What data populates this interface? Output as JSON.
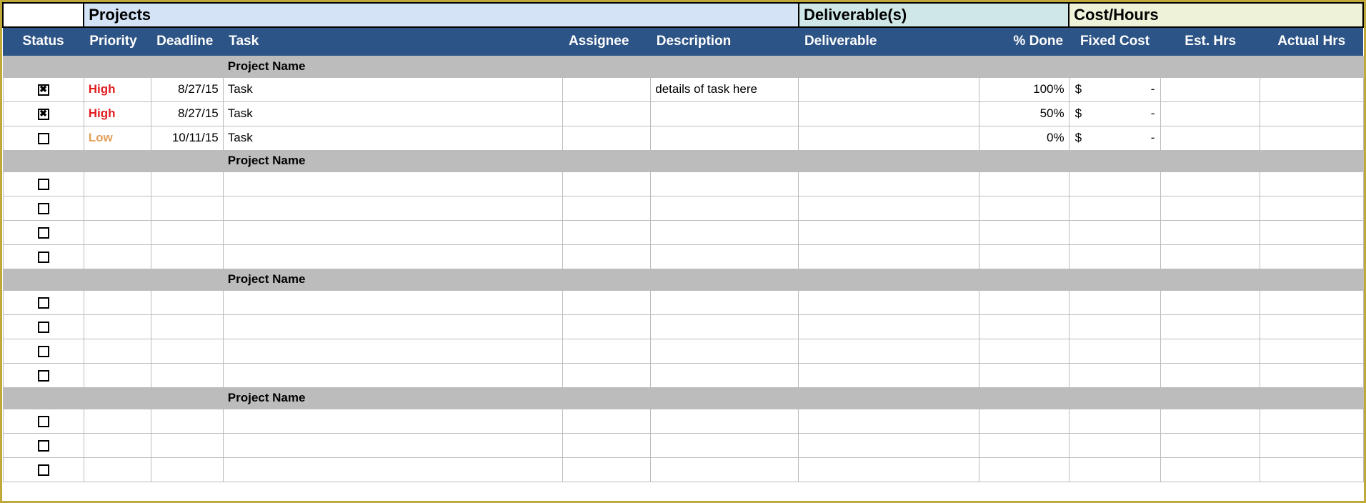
{
  "band": {
    "projects": "Projects",
    "deliverables": "Deliverable(s)",
    "cost": "Cost/Hours"
  },
  "headers": {
    "status": "Status",
    "priority": "Priority",
    "deadline": "Deadline",
    "task": "Task",
    "assignee": "Assignee",
    "description": "Description",
    "deliverable": "Deliverable",
    "done": "% Done",
    "fixed": "Fixed Cost",
    "esthrs": "Est. Hrs",
    "actualhrs": "Actual Hrs"
  },
  "groups": [
    {
      "name": "Project Name",
      "rows": [
        {
          "checked": true,
          "priority": "High",
          "deadline": "8/27/15",
          "task": "Task",
          "assignee": "",
          "description": "details of task here",
          "deliverable": "",
          "done": "100%",
          "fixed_sym": "$",
          "fixed_val": "-",
          "est": "",
          "actual": ""
        },
        {
          "checked": true,
          "priority": "High",
          "deadline": "8/27/15",
          "task": "Task",
          "assignee": "",
          "description": "",
          "deliverable": "",
          "done": "50%",
          "fixed_sym": "$",
          "fixed_val": "-",
          "est": "",
          "actual": ""
        },
        {
          "checked": false,
          "priority": "Low",
          "deadline": "10/11/15",
          "task": "Task",
          "assignee": "",
          "description": "",
          "deliverable": "",
          "done": "0%",
          "fixed_sym": "$",
          "fixed_val": "-",
          "est": "",
          "actual": ""
        }
      ]
    },
    {
      "name": "Project Name",
      "rows": [
        {
          "checked": false,
          "priority": "",
          "deadline": "",
          "task": "",
          "assignee": "",
          "description": "",
          "deliverable": "",
          "done": "",
          "fixed_sym": "",
          "fixed_val": "",
          "est": "",
          "actual": ""
        },
        {
          "checked": false,
          "priority": "",
          "deadline": "",
          "task": "",
          "assignee": "",
          "description": "",
          "deliverable": "",
          "done": "",
          "fixed_sym": "",
          "fixed_val": "",
          "est": "",
          "actual": ""
        },
        {
          "checked": false,
          "priority": "",
          "deadline": "",
          "task": "",
          "assignee": "",
          "description": "",
          "deliverable": "",
          "done": "",
          "fixed_sym": "",
          "fixed_val": "",
          "est": "",
          "actual": ""
        },
        {
          "checked": false,
          "priority": "",
          "deadline": "",
          "task": "",
          "assignee": "",
          "description": "",
          "deliverable": "",
          "done": "",
          "fixed_sym": "",
          "fixed_val": "",
          "est": "",
          "actual": ""
        }
      ]
    },
    {
      "name": "Project Name",
      "rows": [
        {
          "checked": false,
          "priority": "",
          "deadline": "",
          "task": "",
          "assignee": "",
          "description": "",
          "deliverable": "",
          "done": "",
          "fixed_sym": "",
          "fixed_val": "",
          "est": "",
          "actual": ""
        },
        {
          "checked": false,
          "priority": "",
          "deadline": "",
          "task": "",
          "assignee": "",
          "description": "",
          "deliverable": "",
          "done": "",
          "fixed_sym": "",
          "fixed_val": "",
          "est": "",
          "actual": ""
        },
        {
          "checked": false,
          "priority": "",
          "deadline": "",
          "task": "",
          "assignee": "",
          "description": "",
          "deliverable": "",
          "done": "",
          "fixed_sym": "",
          "fixed_val": "",
          "est": "",
          "actual": ""
        },
        {
          "checked": false,
          "priority": "",
          "deadline": "",
          "task": "",
          "assignee": "",
          "description": "",
          "deliverable": "",
          "done": "",
          "fixed_sym": "",
          "fixed_val": "",
          "est": "",
          "actual": ""
        }
      ]
    },
    {
      "name": "Project Name",
      "rows": [
        {
          "checked": false,
          "priority": "",
          "deadline": "",
          "task": "",
          "assignee": "",
          "description": "",
          "deliverable": "",
          "done": "",
          "fixed_sym": "",
          "fixed_val": "",
          "est": "",
          "actual": ""
        },
        {
          "checked": false,
          "priority": "",
          "deadline": "",
          "task": "",
          "assignee": "",
          "description": "",
          "deliverable": "",
          "done": "",
          "fixed_sym": "",
          "fixed_val": "",
          "est": "",
          "actual": ""
        },
        {
          "checked": false,
          "priority": "",
          "deadline": "",
          "task": "",
          "assignee": "",
          "description": "",
          "deliverable": "",
          "done": "",
          "fixed_sym": "",
          "fixed_val": "",
          "est": "",
          "actual": ""
        }
      ]
    }
  ]
}
